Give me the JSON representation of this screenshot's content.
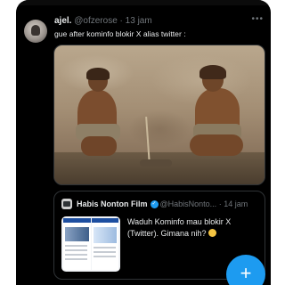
{
  "tweet": {
    "author_name": "ajel.",
    "author_handle": "@ofzerose",
    "separator": "·",
    "time": "13 jam",
    "text": "gue after kominfo blokir X alias twitter :"
  },
  "media": {
    "icon": "caveman-diorama-image"
  },
  "quote": {
    "author_name": "Habis Nonton Film",
    "author_handle": "@HabisNonto...",
    "separator": "·",
    "time": "14 jam",
    "text": "Waduh Kominfo mau blokir X (Twitter). Gimana nih?",
    "verified_icon": "verified-badge-icon",
    "emoji_icon": "grimacing-face-icon"
  },
  "fab": {
    "label": "+"
  },
  "colors": {
    "background": "#000000",
    "text_primary": "#e7e9ea",
    "text_secondary": "#71767b",
    "border": "#2f3336",
    "accent": "#1d9bf0"
  }
}
